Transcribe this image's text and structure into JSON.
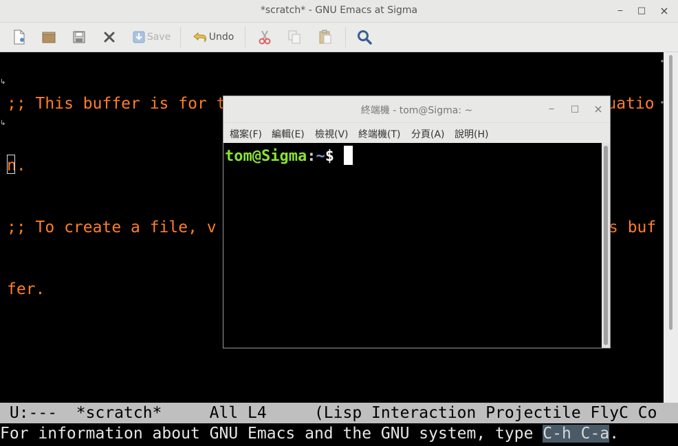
{
  "emacs": {
    "title": "*scratch* - GNU Emacs at Sigma",
    "window_controls": {
      "minimize": "_",
      "maximize": "□",
      "close": "×"
    },
    "toolbar": {
      "new": "new-file-icon",
      "open": "open-folder-icon",
      "save_disk": "save-disk-icon",
      "close": "close-buffer-icon",
      "save_label": "Save",
      "undo_label": "Undo",
      "cut": "cut-icon",
      "copy": "copy-icon",
      "paste": "paste-icon",
      "search": "search-icon"
    },
    "buffer_lines": [
      ";; This buffer is for text that is not saved, and for Lisp evaluatio",
      "n.",
      ";; To create a file, v",
      "fer."
    ],
    "buffer_line3_tail": "s buf",
    "modeline": " U:---  *scratch*     All L4     (Lisp Interaction Projectile FlyC Co",
    "minibuffer_text": "For information about GNU Emacs and the GNU system, type ",
    "minibuffer_key": "C-h C-a",
    "minibuffer_end": ".",
    "colors": {
      "comment": "#ff7f24",
      "background": "#000000",
      "modeline_bg": "#bfbfbf"
    }
  },
  "terminal": {
    "title": "終端機 - tom@Sigma: ~",
    "menus": [
      "檔案(F)",
      "編輯(E)",
      "檢視(V)",
      "終端機(T)",
      "分頁(A)",
      "說明(H)"
    ],
    "prompt_user": "tom@Sigma",
    "prompt_sep": ":",
    "prompt_path": "~",
    "prompt_symbol": "$",
    "colors": {
      "user": "#8ae234",
      "path": "#729fcf"
    }
  }
}
